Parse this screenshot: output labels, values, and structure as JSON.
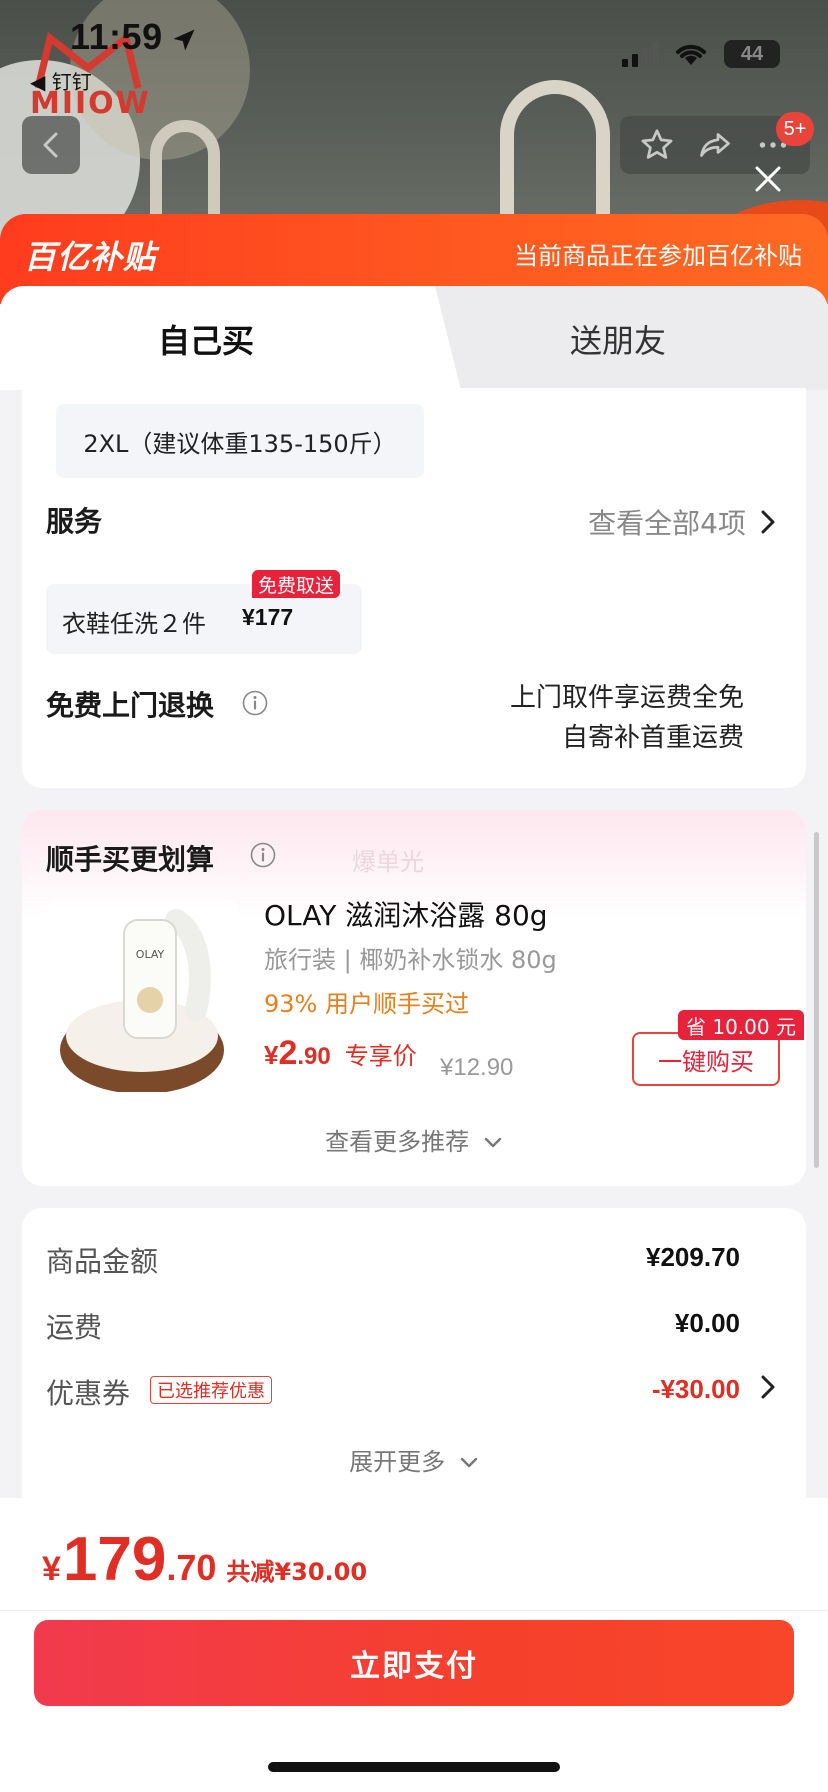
{
  "status_bar": {
    "time": "11:59",
    "back_app": "◀ 钉钉",
    "battery": "44"
  },
  "background": {
    "brand_logo_text": "MIIOW"
  },
  "top_nav": {
    "badge": "5+"
  },
  "subsidy": {
    "logo": "百亿补贴",
    "note": "当前商品正在参加百亿补贴"
  },
  "tabs": [
    {
      "label": "自己买",
      "active": true
    },
    {
      "label": "送朋友",
      "active": false
    }
  ],
  "size": {
    "selected": "2XL（建议体重135-150斤）"
  },
  "service": {
    "title": "服务",
    "view_all": "查看全部4项",
    "item": {
      "name": "衣鞋任洗２件",
      "price": "¥177",
      "tag": "免费取送"
    }
  },
  "returns": {
    "title": "免费上门退换",
    "line1": "上门取件享运费全免",
    "line2": "自寄补首重运费"
  },
  "recommend": {
    "title": "顺手买更划算",
    "watermark": "爆单光",
    "product": {
      "name": "OLAY 滋润沐浴露 80g",
      "sub": "旅行装 | 椰奶补水锁水 80g",
      "hot": "93% 用户顺手买过",
      "price_currency": "¥",
      "price_int": "2",
      "price_dec": ".90",
      "price_label": "专享价",
      "orig_price": "¥12.90",
      "save_tag": "省 10.00 元",
      "buy_label": "一键购买"
    },
    "more": "查看更多推荐"
  },
  "summary": {
    "goods_label": "商品金额",
    "goods_value": "¥209.70",
    "shipping_label": "运费",
    "shipping_value": "¥0.00",
    "coupon_label": "优惠券",
    "coupon_tag": "已选推荐优惠",
    "coupon_value": "-¥30.00",
    "expand": "展开更多"
  },
  "footer": {
    "currency": "¥",
    "total_int": "179",
    "total_dec": ".70",
    "total_saving": "共减¥30.00",
    "pay_label": "立即支付"
  },
  "colors": {
    "accent": "#e02e24",
    "subsidy": "#ff4a1f",
    "pay": "#f23a4f",
    "tag_red": "#e8223a",
    "hot": "#e8801a"
  }
}
